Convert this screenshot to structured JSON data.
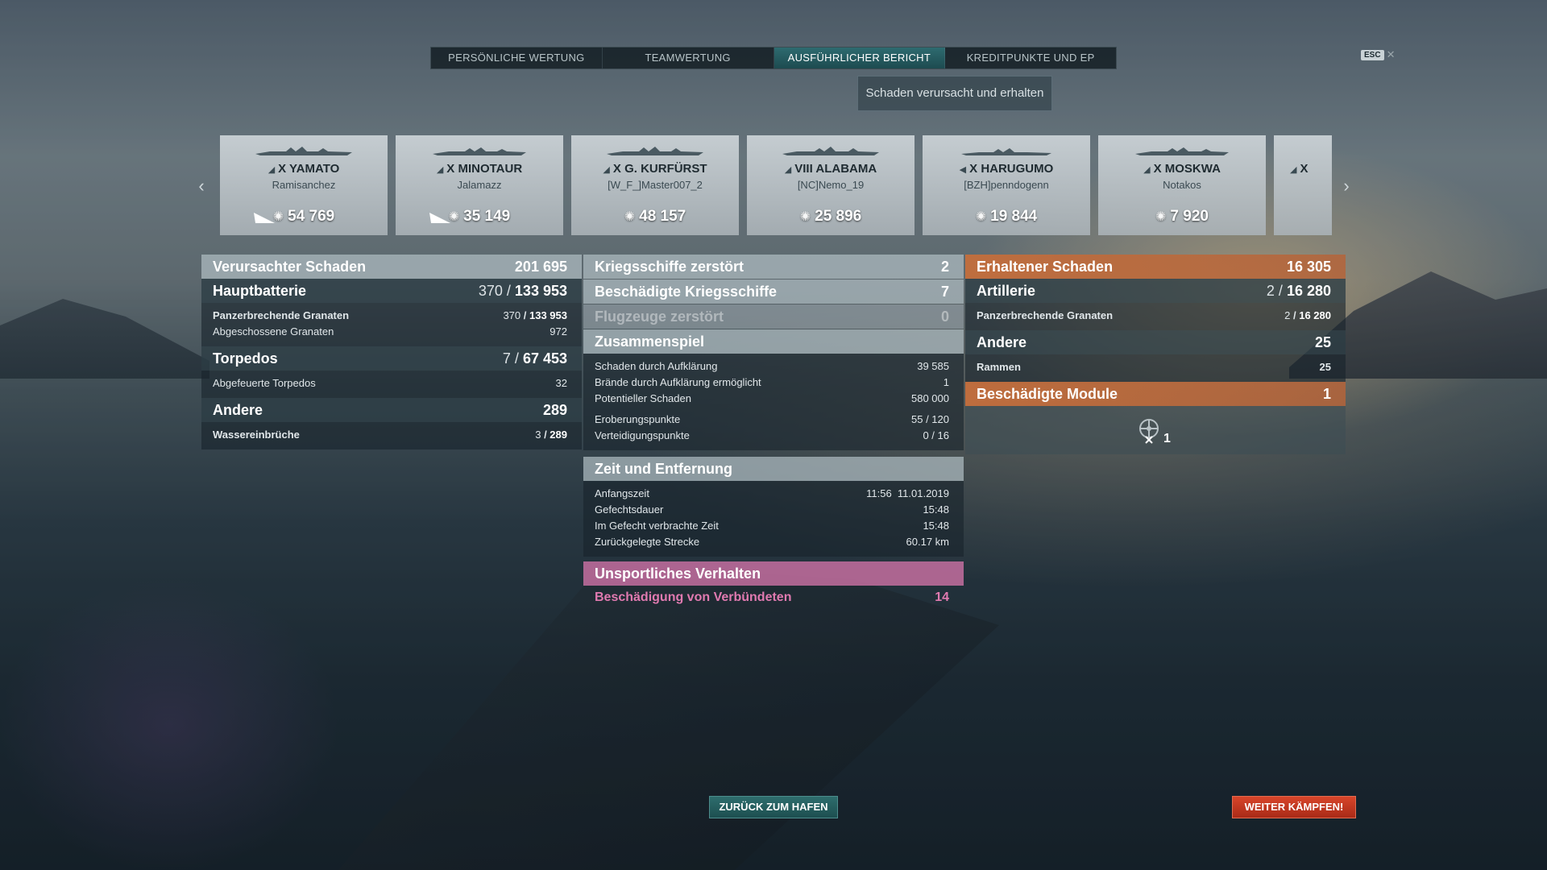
{
  "tabs": [
    {
      "label": "PERSÖNLICHE WERTUNG"
    },
    {
      "label": "TEAMWERTUNG"
    },
    {
      "label": "AUSFÜHRLICHER BERICHT"
    },
    {
      "label": "KREDITPUNKTE UND EP"
    }
  ],
  "active_tab": "AUSFÜHRLICHER BERICHT",
  "esc_label": "ESC",
  "subtab_label": "Schaden verursacht und erhalten",
  "ships": [
    {
      "name": "X YAMATO",
      "player": "Ramisanchez",
      "damage": "54 769",
      "sunk_icon": true
    },
    {
      "name": "X MINOTAUR",
      "player": "Jalamazz",
      "damage": "35 149",
      "sunk_icon": true
    },
    {
      "name": "X G. KURFÜRST",
      "player": "[W_F_]Master007_2",
      "damage": "48 157",
      "sunk_icon": false
    },
    {
      "name": "VIII ALABAMA",
      "player": "[NC]Nemo_19",
      "damage": "25 896",
      "sunk_icon": false
    },
    {
      "name": "X HARUGUMO",
      "player": "[BZH]penndogenn",
      "damage": "19 844",
      "sunk_icon": false
    },
    {
      "name": "X MOSKWA",
      "player": "Notakos",
      "damage": "7 920",
      "sunk_icon": false
    },
    {
      "name": "X",
      "player": "",
      "damage": "",
      "sunk_icon": false
    }
  ],
  "left_panel": {
    "dealt": {
      "label": "Verursachter Schaden",
      "value": "201 695"
    },
    "main_battery": {
      "label": "Hauptbatterie",
      "hits": "370",
      "value": "133 953"
    },
    "ap_shells": {
      "label": "Panzerbrechende Granaten",
      "hits": "370",
      "value": "133 953"
    },
    "shells_fired": {
      "label": "Abgeschossene Granaten",
      "value": "972"
    },
    "torpedoes": {
      "label": "Torpedos",
      "hits": "7",
      "value": "67 453"
    },
    "torpedoes_fired": {
      "label": "Abgefeuerte Torpedos",
      "value": "32"
    },
    "other": {
      "label": "Andere",
      "value": "289"
    },
    "flooding": {
      "label": "Wassereinbrüche",
      "hits": "3",
      "value": "289"
    }
  },
  "mid_panel": {
    "destroyed": {
      "label": "Kriegsschiffe zerstört",
      "value": "2"
    },
    "damaged": {
      "label": "Beschädigte Kriegsschiffe",
      "value": "7"
    },
    "planes": {
      "label": "Flugzeuge zerstört",
      "value": "0"
    },
    "teamplay": {
      "title": "Zusammenspiel",
      "spotting_damage": {
        "label": "Schaden durch Aufklärung",
        "value": "39 585"
      },
      "spotting_fires": {
        "label": "Brände durch Aufklärung ermöglicht",
        "value": "1"
      },
      "potential": {
        "label": "Potentieller Schaden",
        "value": "580 000"
      },
      "capture": {
        "label": "Eroberungspunkte",
        "value": "55 / 120"
      },
      "defense": {
        "label": "Verteidigungspunkte",
        "value": "0 / 16"
      }
    },
    "time": {
      "title": "Zeit und Entfernung",
      "start": {
        "label": "Anfangszeit",
        "value": "11:56  11.01.2019"
      },
      "duration": {
        "label": "Gefechtsdauer",
        "value": "15:48"
      },
      "in_battle": {
        "label": "Im Gefecht verbrachte Zeit",
        "value": "15:48"
      },
      "distance": {
        "label": "Zurückgelegte Strecke",
        "value": "60.17 km"
      }
    },
    "unsport": {
      "title": "Unsportliches Verhalten",
      "ally_damage": {
        "label": "Beschädigung von Verbündeten",
        "value": "14"
      }
    }
  },
  "right_panel": {
    "received": {
      "label": "Erhaltener Schaden",
      "value": "16 305"
    },
    "artillery": {
      "label": "Artillerie",
      "hits": "2",
      "value": "16 280"
    },
    "ap_shells": {
      "label": "Panzerbrechende Granaten",
      "hits": "2",
      "value": "16 280"
    },
    "other": {
      "label": "Andere",
      "value": "25"
    },
    "ramming": {
      "label": "Rammen",
      "value": "25"
    },
    "modules": {
      "label": "Beschädigte Module",
      "value": "1"
    },
    "module_count": "1"
  },
  "buttons": {
    "port": "ZURÜCK ZUM HAFEN",
    "fight": "WEITER KÄMPFEN!"
  },
  "colors": {
    "accent_teal": "#2e6b70",
    "received_orange": "#c46e3c",
    "unsport_pink": "#c46ea0",
    "fight_red": "#d8452a"
  }
}
